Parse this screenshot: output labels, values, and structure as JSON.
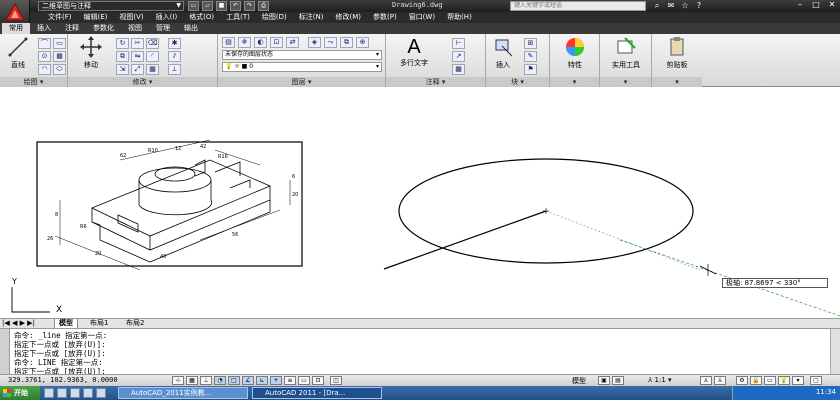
{
  "titlebar": {
    "workspace": "二维草图与注释",
    "document": "Drawing6.dwg",
    "search_placeholder": "键入关键字或短语"
  },
  "menu": [
    "文件(F)",
    "编辑(E)",
    "视图(V)",
    "插入(I)",
    "格式(O)",
    "工具(T)",
    "绘图(D)",
    "标注(N)",
    "修改(M)",
    "参数(P)",
    "窗口(W)",
    "帮助(H)"
  ],
  "ribbon_tabs": [
    "常用",
    "插入",
    "注释",
    "参数化",
    "视图",
    "管理",
    "输出"
  ],
  "ribbon": {
    "draw_label": "绘图",
    "modify_label": "修改",
    "layers_label": "图层",
    "annotation_label": "注释",
    "block_label": "块",
    "line_btn": "直线",
    "move_btn": "移动",
    "layer_state": "未保存的图层状态",
    "current_layer": "0",
    "mtext_btn": "多行文字",
    "insert_btn": "插入",
    "props_btn": "特性",
    "utils_btn": "实用工具",
    "clipboard_btn": "剪贴板"
  },
  "canvas": {
    "dynamic_tooltip": "极轴: 87.8697 < 330°",
    "ucs_x": "X",
    "ucs_y": "Y",
    "dim_labels": [
      "62",
      "R10",
      "12",
      "42",
      "R16",
      "6",
      "20",
      "8",
      "26",
      "20",
      "56",
      "40",
      "R6"
    ]
  },
  "layout_tabs": [
    "模型",
    "布局1",
    "布局2"
  ],
  "command_lines": [
    "命令:  _line 指定第一点:",
    "指定下一点或 [放弃(U)]:",
    "指定下一点或 [放弃(U)]:",
    "命令:  LINE 指定第一点:",
    "指定下一点或 [放弃(U)]:"
  ],
  "status": {
    "coords": "329.3761, 102.9363, 0.0000",
    "model": "模型",
    "scale": "1:1"
  },
  "taskbar": {
    "start": "开始",
    "tasks": [
      "AutoCAD_2011实例教...",
      "AutoCAD 2011 - [Dra..."
    ],
    "clock": "11:34"
  }
}
